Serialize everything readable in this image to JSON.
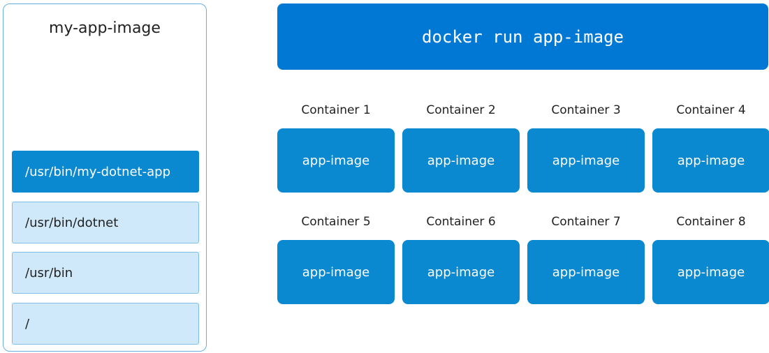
{
  "image": {
    "title": "my-app-image",
    "layers": [
      "/usr/bin/my-dotnet-app",
      "/usr/bin/dotnet",
      "/usr/bin",
      "/"
    ]
  },
  "command": "docker run app-image",
  "containers": [
    {
      "label": "Container 1",
      "image": "app-image"
    },
    {
      "label": "Container 2",
      "image": "app-image"
    },
    {
      "label": "Container 3",
      "image": "app-image"
    },
    {
      "label": "Container 4",
      "image": "app-image"
    },
    {
      "label": "Container 5",
      "image": "app-image"
    },
    {
      "label": "Container 6",
      "image": "app-image"
    },
    {
      "label": "Container 7",
      "image": "app-image"
    },
    {
      "label": "Container 8",
      "image": "app-image"
    }
  ],
  "colors": {
    "accent_blue": "#0078d4",
    "container_blue": "#0a89d0",
    "layer_light": "#cfe9fa",
    "panel_border": "#6aaee0"
  }
}
